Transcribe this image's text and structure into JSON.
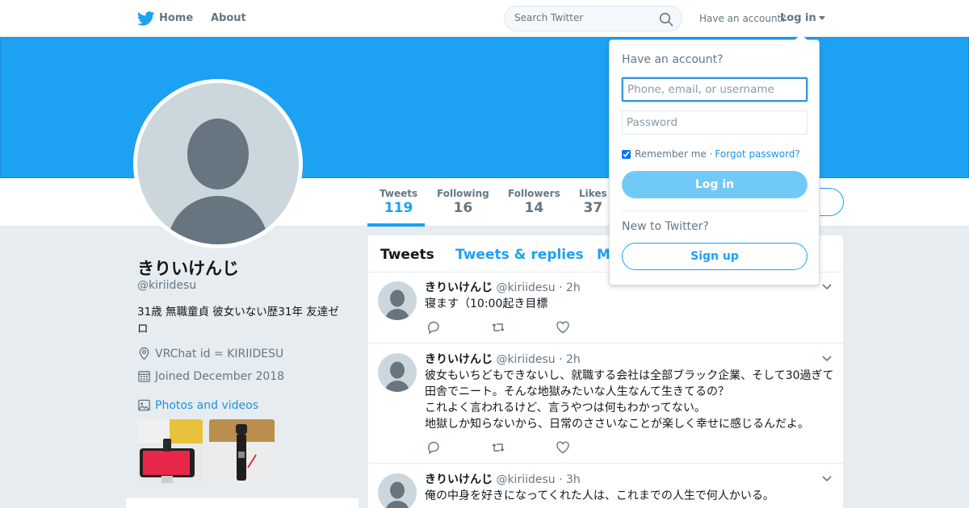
{
  "nav": {
    "home_label": "Home",
    "about_label": "About",
    "search_placeholder": "Search Twitter",
    "have_account": "Have an account?",
    "login_label": "Log in"
  },
  "profile": {
    "name": "きりいけんじ",
    "handle": "@kiriidesu",
    "bio": "31歳 無職童貞 彼女いない歴31年 友達ゼロ",
    "location": "VRChat id = KIRIIDESU",
    "joined": "Joined December 2018",
    "photos_label": "Photos and videos"
  },
  "stats": [
    {
      "label": "Tweets",
      "value": "119"
    },
    {
      "label": "Following",
      "value": "16"
    },
    {
      "label": "Followers",
      "value": "14"
    },
    {
      "label": "Likes",
      "value": "37"
    }
  ],
  "timeline": {
    "tabs": [
      "Tweets",
      "Tweets & replies",
      "M"
    ],
    "tweets": [
      {
        "name": "きりいけんじ",
        "handle": "@kiriidesu",
        "time": "· 2h",
        "text": "寝ます（10:00起き目標"
      },
      {
        "name": "きりいけんじ",
        "handle": "@kiriidesu",
        "time": "· 2h",
        "text": "彼女もいちどもできないし、就職する会社は全部ブラック企業、そして30過ぎて\n田舎でニート。そんな地獄みたいな人生なんて生きてるの？\nこれよく言われるけど、言うやつは何もわかってない。\n地獄しか知らないから、日常のささいなことが楽しく幸せに感じるんだよ。"
      },
      {
        "name": "きりいけんじ",
        "handle": "@kiriidesu",
        "time": "· 3h",
        "text": "俺の中身を好きになってくれた人は、これまでの人生で何人かいる。"
      }
    ]
  },
  "login_dropdown": {
    "title": "Have an account?",
    "username_placeholder": "Phone, email, or username",
    "password_placeholder": "Password",
    "remember": "Remember me",
    "separator": "·",
    "forgot": "Forgot password?",
    "login_button": "Log in",
    "new_to": "New to Twitter?",
    "signup_button": "Sign up"
  },
  "colors": {
    "brand": "#1da1f2",
    "background": "#e6ecf0"
  }
}
